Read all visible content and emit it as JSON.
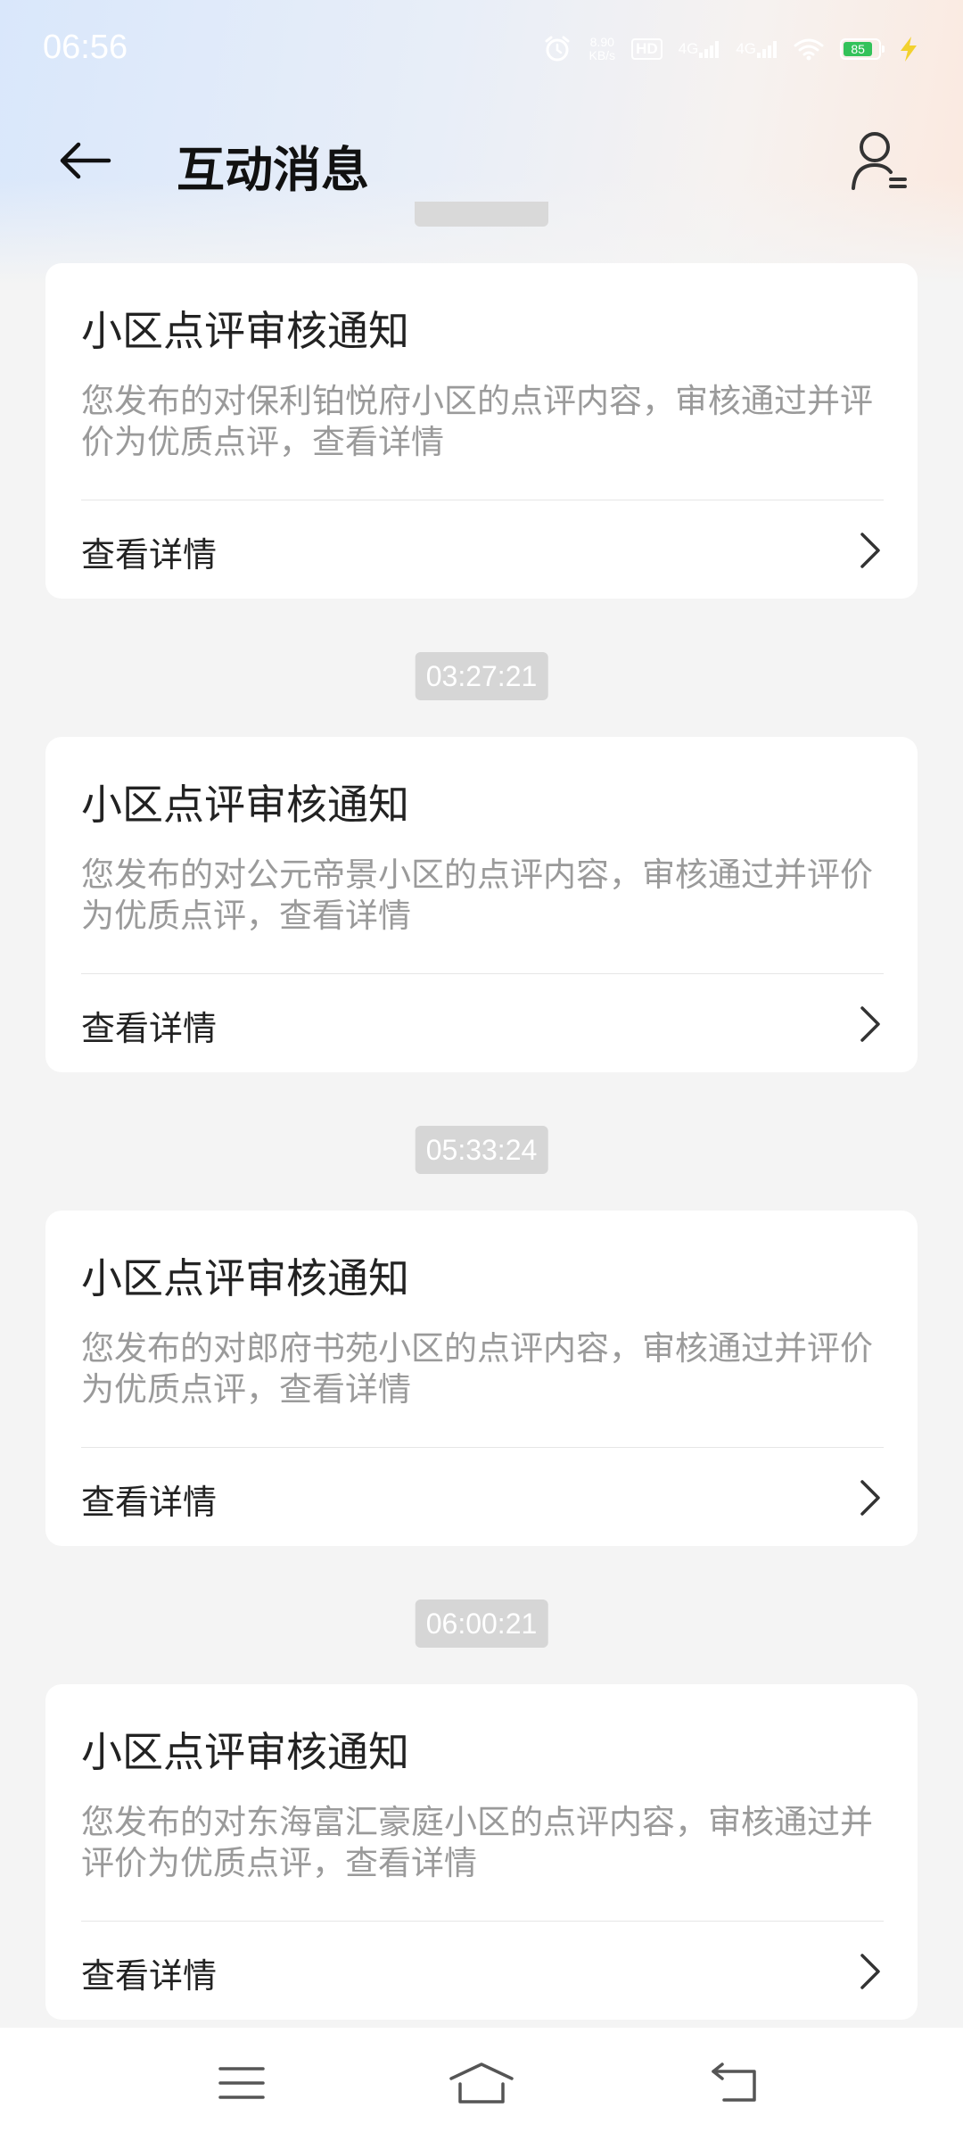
{
  "status_bar": {
    "time": "06:56",
    "net_speed_value": "8.90",
    "net_speed_unit": "KB/s",
    "hd_label": "HD",
    "sim1_label": "4G",
    "sim2_label": "4G",
    "battery_percent": "85",
    "battery_level": 0.85
  },
  "header": {
    "title": "互动消息",
    "back_icon": "arrow-left-icon",
    "user_icon": "user-settings-icon"
  },
  "messages": [
    {
      "title": "小区点评审核通知",
      "desc": "您发布的对保利铂悦府小区的点评内容，审核通过并评价为优质点评，查看详情",
      "link_label": "查看详情"
    },
    {
      "time": "03:27:21",
      "title": "小区点评审核通知",
      "desc": "您发布的对公元帝景小区的点评内容，审核通过并评价为优质点评，查看详情",
      "link_label": "查看详情"
    },
    {
      "time": "05:33:24",
      "title": "小区点评审核通知",
      "desc": "您发布的对郎府书苑小区的点评内容，审核通过并评价为优质点评，查看详情",
      "link_label": "查看详情"
    },
    {
      "time": "06:00:21",
      "title": "小区点评审核通知",
      "desc": "您发布的对东海富汇豪庭小区的点评内容，审核通过并评价为优质点评，查看详情",
      "link_label": "查看详情"
    }
  ],
  "bottom_nav": {
    "menu_icon": "menu-icon",
    "home_icon": "home-icon",
    "back_icon": "back-icon"
  },
  "colors": {
    "card_bg": "#ffffff",
    "page_bg": "#f4f4f4",
    "title_text": "#111111",
    "desc_text": "#9a9a9a",
    "time_pill_bg": "#d6d6d6",
    "battery_green": "#33c25a"
  }
}
